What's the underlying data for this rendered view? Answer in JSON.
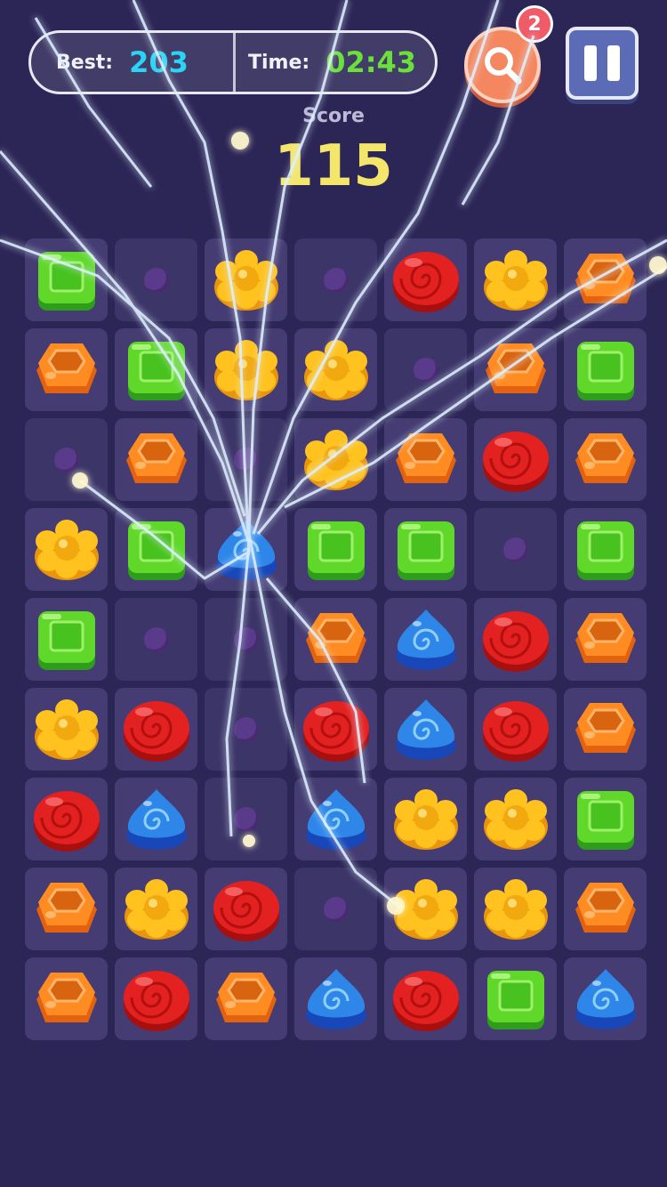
{
  "hud": {
    "best_label": "Best:",
    "best_value": "203",
    "time_label": "Time:",
    "time_value": "02:43",
    "hint_count": "2"
  },
  "score": {
    "label": "Score",
    "value": "115"
  },
  "colors": {
    "background": "#2c2657",
    "best_value": "#2bd3f5",
    "time_value": "#6be03a",
    "score_value": "#f4e66a",
    "search_button": "#f4875f",
    "pause_button": "#5c6bb6"
  },
  "board": {
    "columns": 7,
    "rows": [
      [
        "green-square",
        "empty",
        "yellow-flower",
        "empty",
        "red-swirl",
        "yellow-flower",
        "orange-hexagon"
      ],
      [
        "orange-hexagon",
        "green-square",
        "yellow-flower",
        "yellow-flower",
        "empty",
        "orange-hexagon",
        "green-square"
      ],
      [
        "empty",
        "orange-hexagon",
        "empty",
        "yellow-flower",
        "orange-hexagon",
        "red-swirl",
        "orange-hexagon"
      ],
      [
        "yellow-flower",
        "green-square",
        "blue-drop",
        "green-square",
        "green-square",
        "empty",
        "green-square"
      ],
      [
        "green-square",
        "empty",
        "empty",
        "orange-hexagon",
        "blue-drop",
        "red-swirl",
        "orange-hexagon"
      ],
      [
        "yellow-flower",
        "red-swirl",
        "empty",
        "red-swirl",
        "blue-drop",
        "red-swirl",
        "orange-hexagon"
      ],
      [
        "red-swirl",
        "blue-drop",
        "empty",
        "blue-drop",
        "yellow-flower",
        "yellow-flower",
        "green-square"
      ],
      [
        "orange-hexagon",
        "yellow-flower",
        "red-swirl",
        "empty",
        "yellow-flower",
        "yellow-flower",
        "orange-hexagon"
      ],
      [
        "orange-hexagon",
        "red-swirl",
        "orange-hexagon",
        "blue-drop",
        "red-swirl",
        "green-square",
        "blue-drop"
      ]
    ]
  }
}
